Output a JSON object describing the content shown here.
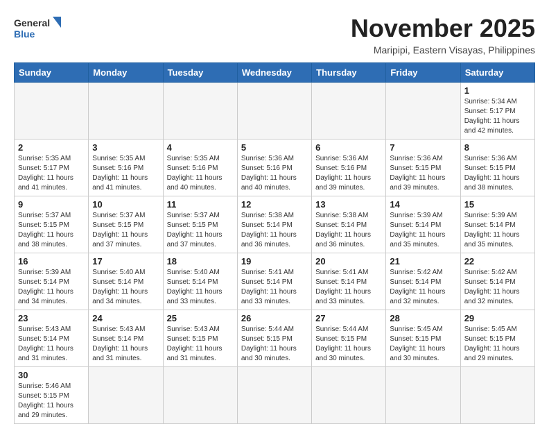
{
  "logo": {
    "line1": "General",
    "line2": "Blue"
  },
  "title": "November 2025",
  "location": "Maripipi, Eastern Visayas, Philippines",
  "weekdays": [
    "Sunday",
    "Monday",
    "Tuesday",
    "Wednesday",
    "Thursday",
    "Friday",
    "Saturday"
  ],
  "weeks": [
    [
      {
        "day": "",
        "info": ""
      },
      {
        "day": "",
        "info": ""
      },
      {
        "day": "",
        "info": ""
      },
      {
        "day": "",
        "info": ""
      },
      {
        "day": "",
        "info": ""
      },
      {
        "day": "",
        "info": ""
      },
      {
        "day": "1",
        "info": "Sunrise: 5:34 AM\nSunset: 5:17 PM\nDaylight: 11 hours\nand 42 minutes."
      }
    ],
    [
      {
        "day": "2",
        "info": "Sunrise: 5:35 AM\nSunset: 5:17 PM\nDaylight: 11 hours\nand 41 minutes."
      },
      {
        "day": "3",
        "info": "Sunrise: 5:35 AM\nSunset: 5:16 PM\nDaylight: 11 hours\nand 41 minutes."
      },
      {
        "day": "4",
        "info": "Sunrise: 5:35 AM\nSunset: 5:16 PM\nDaylight: 11 hours\nand 40 minutes."
      },
      {
        "day": "5",
        "info": "Sunrise: 5:36 AM\nSunset: 5:16 PM\nDaylight: 11 hours\nand 40 minutes."
      },
      {
        "day": "6",
        "info": "Sunrise: 5:36 AM\nSunset: 5:16 PM\nDaylight: 11 hours\nand 39 minutes."
      },
      {
        "day": "7",
        "info": "Sunrise: 5:36 AM\nSunset: 5:15 PM\nDaylight: 11 hours\nand 39 minutes."
      },
      {
        "day": "8",
        "info": "Sunrise: 5:36 AM\nSunset: 5:15 PM\nDaylight: 11 hours\nand 38 minutes."
      }
    ],
    [
      {
        "day": "9",
        "info": "Sunrise: 5:37 AM\nSunset: 5:15 PM\nDaylight: 11 hours\nand 38 minutes."
      },
      {
        "day": "10",
        "info": "Sunrise: 5:37 AM\nSunset: 5:15 PM\nDaylight: 11 hours\nand 37 minutes."
      },
      {
        "day": "11",
        "info": "Sunrise: 5:37 AM\nSunset: 5:15 PM\nDaylight: 11 hours\nand 37 minutes."
      },
      {
        "day": "12",
        "info": "Sunrise: 5:38 AM\nSunset: 5:14 PM\nDaylight: 11 hours\nand 36 minutes."
      },
      {
        "day": "13",
        "info": "Sunrise: 5:38 AM\nSunset: 5:14 PM\nDaylight: 11 hours\nand 36 minutes."
      },
      {
        "day": "14",
        "info": "Sunrise: 5:39 AM\nSunset: 5:14 PM\nDaylight: 11 hours\nand 35 minutes."
      },
      {
        "day": "15",
        "info": "Sunrise: 5:39 AM\nSunset: 5:14 PM\nDaylight: 11 hours\nand 35 minutes."
      }
    ],
    [
      {
        "day": "16",
        "info": "Sunrise: 5:39 AM\nSunset: 5:14 PM\nDaylight: 11 hours\nand 34 minutes."
      },
      {
        "day": "17",
        "info": "Sunrise: 5:40 AM\nSunset: 5:14 PM\nDaylight: 11 hours\nand 34 minutes."
      },
      {
        "day": "18",
        "info": "Sunrise: 5:40 AM\nSunset: 5:14 PM\nDaylight: 11 hours\nand 33 minutes."
      },
      {
        "day": "19",
        "info": "Sunrise: 5:41 AM\nSunset: 5:14 PM\nDaylight: 11 hours\nand 33 minutes."
      },
      {
        "day": "20",
        "info": "Sunrise: 5:41 AM\nSunset: 5:14 PM\nDaylight: 11 hours\nand 33 minutes."
      },
      {
        "day": "21",
        "info": "Sunrise: 5:42 AM\nSunset: 5:14 PM\nDaylight: 11 hours\nand 32 minutes."
      },
      {
        "day": "22",
        "info": "Sunrise: 5:42 AM\nSunset: 5:14 PM\nDaylight: 11 hours\nand 32 minutes."
      }
    ],
    [
      {
        "day": "23",
        "info": "Sunrise: 5:43 AM\nSunset: 5:14 PM\nDaylight: 11 hours\nand 31 minutes."
      },
      {
        "day": "24",
        "info": "Sunrise: 5:43 AM\nSunset: 5:14 PM\nDaylight: 11 hours\nand 31 minutes."
      },
      {
        "day": "25",
        "info": "Sunrise: 5:43 AM\nSunset: 5:15 PM\nDaylight: 11 hours\nand 31 minutes."
      },
      {
        "day": "26",
        "info": "Sunrise: 5:44 AM\nSunset: 5:15 PM\nDaylight: 11 hours\nand 30 minutes."
      },
      {
        "day": "27",
        "info": "Sunrise: 5:44 AM\nSunset: 5:15 PM\nDaylight: 11 hours\nand 30 minutes."
      },
      {
        "day": "28",
        "info": "Sunrise: 5:45 AM\nSunset: 5:15 PM\nDaylight: 11 hours\nand 30 minutes."
      },
      {
        "day": "29",
        "info": "Sunrise: 5:45 AM\nSunset: 5:15 PM\nDaylight: 11 hours\nand 29 minutes."
      }
    ],
    [
      {
        "day": "30",
        "info": "Sunrise: 5:46 AM\nSunset: 5:15 PM\nDaylight: 11 hours\nand 29 minutes."
      },
      {
        "day": "",
        "info": ""
      },
      {
        "day": "",
        "info": ""
      },
      {
        "day": "",
        "info": ""
      },
      {
        "day": "",
        "info": ""
      },
      {
        "day": "",
        "info": ""
      },
      {
        "day": "",
        "info": ""
      }
    ]
  ]
}
